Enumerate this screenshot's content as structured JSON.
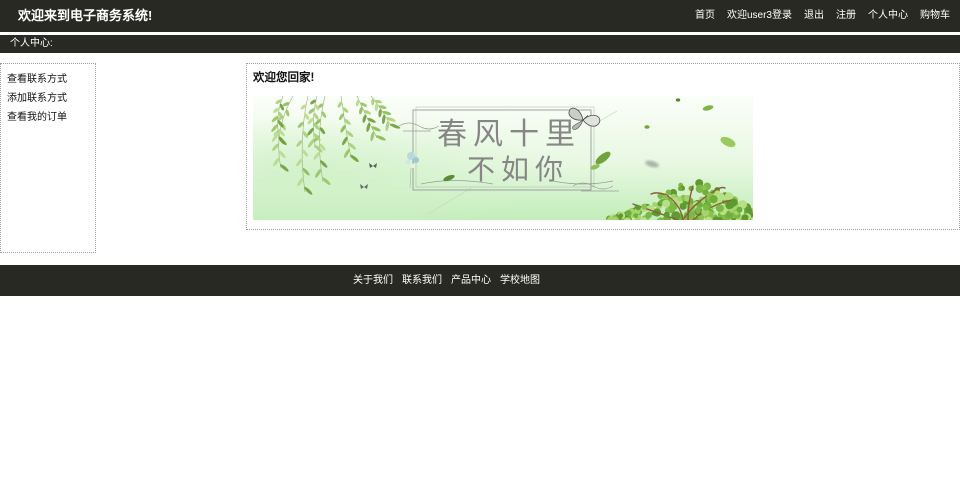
{
  "header": {
    "title": "欢迎来到电子商务系统!",
    "nav": {
      "home": "首页",
      "welcome": "欢迎user3登录",
      "logout": "退出",
      "register": "注册",
      "profile": "个人中心",
      "cart": "购物车"
    }
  },
  "subheader": {
    "label": "个人中心:"
  },
  "sidebar": {
    "items": [
      "查看联系方式",
      "添加联系方式",
      "查看我的订单"
    ]
  },
  "main": {
    "heading": "欢迎您回家!",
    "banner": {
      "line1": "春风十里",
      "line2": "不如你"
    }
  },
  "footer": {
    "links": [
      "关于我们",
      "联系我们",
      "产品中心",
      "学校地图"
    ]
  },
  "colors": {
    "bar_background": "#292924",
    "bar_text": "#ffffff",
    "box_border": "#9e9e9e",
    "body_text": "#111111"
  }
}
